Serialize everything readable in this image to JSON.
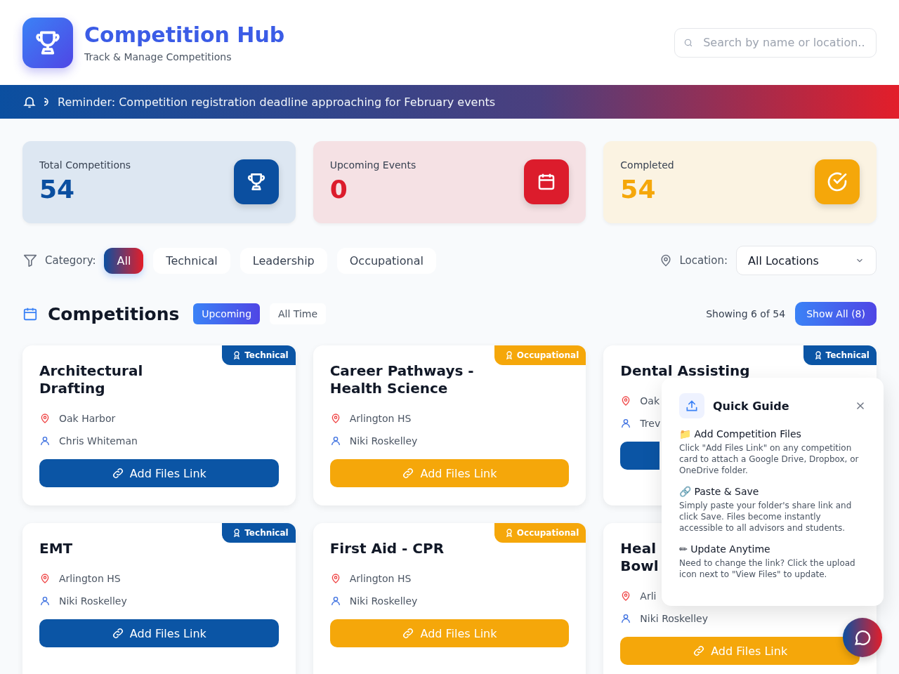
{
  "header": {
    "title": "Competition Hub",
    "subtitle": "Track & Manage Competitions",
    "search": {
      "placeholder": "Search by name or location..."
    }
  },
  "banner": {
    "text": "Reminder: Competition registration deadline approaching for February events"
  },
  "stats": [
    {
      "kind": "total",
      "label": "Total Competitions",
      "value": "54"
    },
    {
      "kind": "upcoming",
      "label": "Upcoming Events",
      "value": "0"
    },
    {
      "kind": "completed",
      "label": "Completed",
      "value": "54"
    }
  ],
  "filters": {
    "category_label": "Category:",
    "categories": [
      {
        "label": "All",
        "selected": true
      },
      {
        "label": "Technical",
        "selected": false
      },
      {
        "label": "Leadership",
        "selected": false
      },
      {
        "label": "Occupational",
        "selected": false
      }
    ],
    "location_label": "Location:",
    "location_value": "All Locations"
  },
  "section": {
    "title": "Competitions",
    "tabs": [
      {
        "label": "Upcoming",
        "selected": true
      },
      {
        "label": "All Time",
        "selected": false
      }
    ],
    "showing": "Showing 6 of 54",
    "show_all": "Show All (8)"
  },
  "cards": [
    {
      "kind": "technical",
      "tag": "Technical",
      "title_lines": [
        "Architectural",
        "Drafting"
      ],
      "location": "Oak Harbor",
      "advisor": "Chris Whiteman",
      "button": "Add Files Link"
    },
    {
      "kind": "occupational",
      "tag": "Occupational",
      "title_lines": [
        "Career Pathways -",
        "Health Science"
      ],
      "location": "Arlington HS",
      "advisor": "Niki Roskelley",
      "button": "Add Files Link"
    },
    {
      "kind": "technical",
      "tag": "Technical",
      "title_lines": [
        "Dental Assisting"
      ],
      "location": "Oak",
      "advisor": "Trev"
    },
    {
      "kind": "technical",
      "tag": "Technical",
      "title_lines": [
        "EMT"
      ],
      "location": "Arlington HS",
      "advisor": "Niki Roskelley",
      "button": "Add Files Link"
    },
    {
      "kind": "occupational",
      "tag": "Occupational",
      "title_lines": [
        "First Aid - CPR"
      ],
      "location": "Arlington HS",
      "advisor": "Niki Roskelley",
      "button": "Add Files Link"
    },
    {
      "kind": "occupational",
      "title_lines": [
        "Heal",
        "Bowl"
      ],
      "location": "Arli",
      "advisor": "Niki Roskelley",
      "button": "Add Files Link"
    }
  ],
  "guide": {
    "title": "Quick Guide",
    "steps": [
      {
        "icon": "📁",
        "title": "Add Competition Files",
        "text": "Click \"Add Files Link\" on any competition card to attach a Google Drive, Dropbox, or OneDrive folder."
      },
      {
        "icon": "🔗",
        "title": "Paste & Save",
        "text": "Simply paste your folder's share link and click Save. Files become instantly accessible to all advisors and students."
      },
      {
        "icon": "✏",
        "title": "Update Anytime",
        "text": "Need to change the link? Click the upload icon next to \"View Files\" to update."
      }
    ]
  }
}
